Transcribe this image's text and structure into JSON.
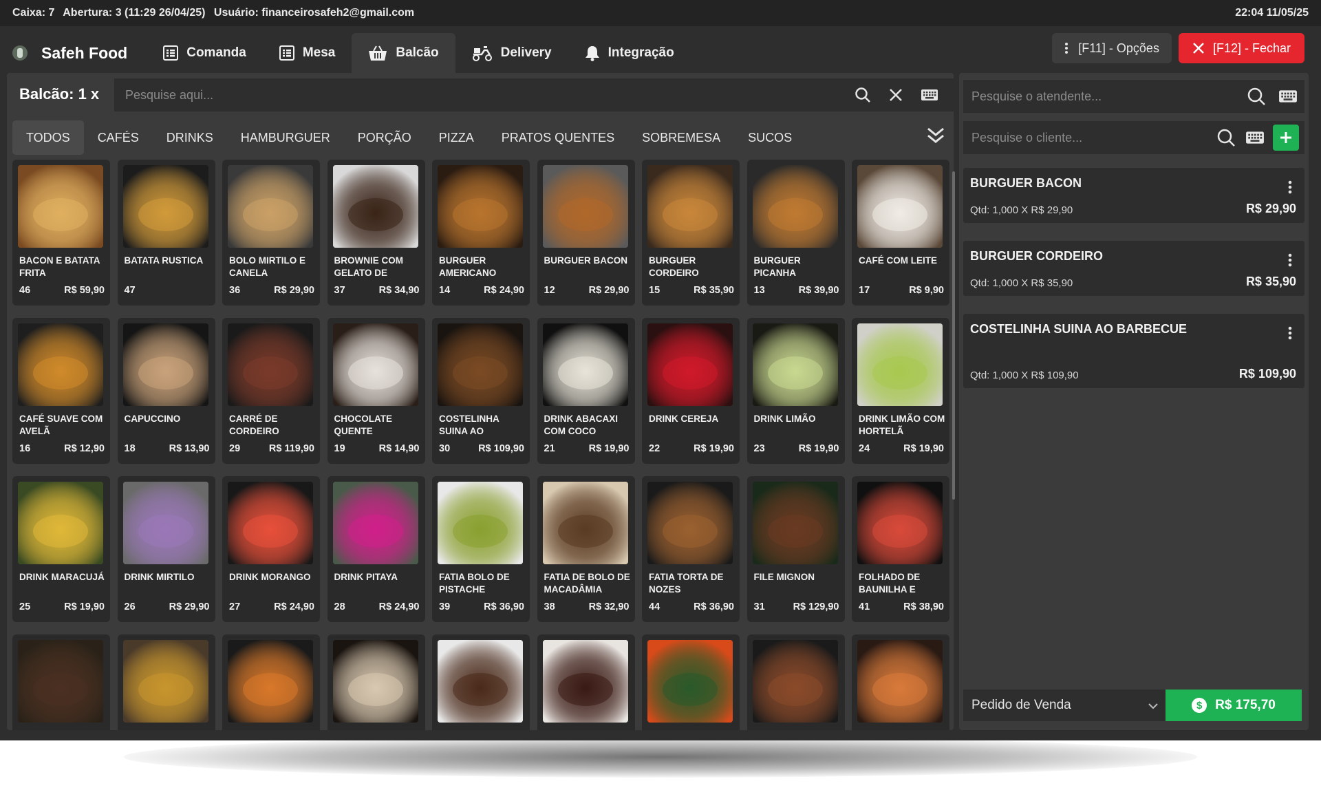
{
  "statusbar": {
    "caixa": "Caixa: 7",
    "abertura": "Abertura: 3 (11:29 26/04/25)",
    "usuario": "Usuário: financeirosafeh2@gmail.com",
    "datetime": "22:04 11/05/25"
  },
  "nav": {
    "brand": "Safeh Food",
    "tabs": [
      {
        "label": "Comanda",
        "icon": "list-icon"
      },
      {
        "label": "Mesa",
        "icon": "list-icon"
      },
      {
        "label": "Balcão",
        "icon": "basket-icon",
        "active": true
      },
      {
        "label": "Delivery",
        "icon": "scooter-icon"
      },
      {
        "label": "Integração",
        "icon": "bell-icon"
      }
    ],
    "options_label": "[F11] - Opções",
    "close_label": "[F12] - Fechar"
  },
  "balcao": {
    "title": "Balcão: 1 x",
    "search_placeholder": "Pesquise aqui...",
    "categories": [
      "TODOS",
      "CAFÉS",
      "DRINKS",
      "HAMBURGUER",
      "PORÇÃO",
      "PIZZA",
      "PRATOS QUENTES",
      "SOBREMESA",
      "SUCOS"
    ],
    "active_category": "TODOS"
  },
  "products": [
    {
      "name": "BACON E BATATA FRITA",
      "code": "46",
      "price": "R$ 59,90",
      "colors": [
        "#7a4a22",
        "#e0b060"
      ]
    },
    {
      "name": "BATATA RUSTICA",
      "code": "47",
      "price": "",
      "colors": [
        "#1c1c1c",
        "#d19a3a"
      ]
    },
    {
      "name": "BOLO MIRTILO E CANELA",
      "code": "36",
      "price": "R$ 29,90",
      "colors": [
        "#3a3a3a",
        "#caa066"
      ]
    },
    {
      "name": "BROWNIE COM GELATO DE",
      "code": "37",
      "price": "R$ 34,90",
      "colors": [
        "#d8d8d8",
        "#3a2418"
      ]
    },
    {
      "name": "BURGUER AMERICANO",
      "code": "14",
      "price": "R$ 24,90",
      "colors": [
        "#2b1c12",
        "#b8742e"
      ]
    },
    {
      "name": "BURGUER BACON",
      "code": "12",
      "price": "R$ 29,90",
      "colors": [
        "#5a5a5a",
        "#b0682a"
      ]
    },
    {
      "name": "BURGUER CORDEIRO",
      "code": "15",
      "price": "R$ 35,90",
      "colors": [
        "#3a2a1e",
        "#c8863a"
      ]
    },
    {
      "name": "BURGUER PICANHA",
      "code": "13",
      "price": "R$ 39,90",
      "colors": [
        "#2a2a2a",
        "#c07a32"
      ]
    },
    {
      "name": "CAFÉ COM LEITE",
      "code": "17",
      "price": "R$ 9,90",
      "colors": [
        "#5a4838",
        "#f0ece6"
      ]
    },
    {
      "name": "CAFÉ SUAVE COM AVELÃ",
      "code": "16",
      "price": "R$ 12,90",
      "colors": [
        "#1e1e1e",
        "#d08a2a"
      ]
    },
    {
      "name": "CAPUCCINO",
      "code": "18",
      "price": "R$ 13,90",
      "colors": [
        "#151515",
        "#c9a27a"
      ]
    },
    {
      "name": "CARRÉ DE CORDEIRO",
      "code": "29",
      "price": "R$ 119,90",
      "colors": [
        "#1a1a1a",
        "#7a3a2a"
      ]
    },
    {
      "name": "CHOCOLATE QUENTE",
      "code": "19",
      "price": "R$ 14,90",
      "colors": [
        "#2a1e18",
        "#e8e2dc"
      ]
    },
    {
      "name": "COSTELINHA SUINA AO",
      "code": "30",
      "price": "R$ 109,90",
      "colors": [
        "#1a1410",
        "#7a4a24"
      ]
    },
    {
      "name": "DRINK ABACAXI COM COCO",
      "code": "21",
      "price": "R$ 19,90",
      "colors": [
        "#101010",
        "#e8e4d8"
      ]
    },
    {
      "name": "DRINK CEREJA",
      "code": "22",
      "price": "R$ 19,90",
      "colors": [
        "#2a1010",
        "#d01a2a"
      ]
    },
    {
      "name": "DRINK LIMÃO",
      "code": "23",
      "price": "R$ 19,90",
      "colors": [
        "#1a1a14",
        "#c8d890"
      ]
    },
    {
      "name": "DRINK LIMÃO COM HORTELÃ",
      "code": "24",
      "price": "R$ 19,90",
      "colors": [
        "#d0d0c8",
        "#a8c850"
      ]
    },
    {
      "name": "DRINK MARACUJÁ",
      "code": "25",
      "price": "R$ 19,90",
      "colors": [
        "#3a4a22",
        "#e0b838"
      ]
    },
    {
      "name": "DRINK MIRTILO",
      "code": "26",
      "price": "R$ 29,90",
      "colors": [
        "#6a6a6a",
        "#9a78b8"
      ]
    },
    {
      "name": "DRINK MORANGO",
      "code": "27",
      "price": "R$ 24,90",
      "colors": [
        "#181818",
        "#e8503a"
      ]
    },
    {
      "name": "DRINK PITAYA",
      "code": "28",
      "price": "R$ 24,90",
      "colors": [
        "#4a5a4a",
        "#d0208a"
      ]
    },
    {
      "name": "FATIA BOLO DE PISTACHE",
      "code": "39",
      "price": "R$ 36,90",
      "colors": [
        "#e8e8e8",
        "#8aa030"
      ]
    },
    {
      "name": "FATIA DE BOLO DE MACADÂMIA",
      "code": "38",
      "price": "R$ 32,90",
      "colors": [
        "#d8c8b0",
        "#5a3a22"
      ]
    },
    {
      "name": "FATIA TORTA DE NOZES",
      "code": "44",
      "price": "R$ 36,90",
      "colors": [
        "#1a1a1a",
        "#9a6030"
      ]
    },
    {
      "name": "FILE MIGNON",
      "code": "31",
      "price": "R$ 129,90",
      "colors": [
        "#1a2a1a",
        "#6a3a22"
      ]
    },
    {
      "name": "FOLHADO DE BAUNILHA E",
      "code": "41",
      "price": "R$ 38,90",
      "colors": [
        "#101010",
        "#d84a3a"
      ]
    },
    {
      "name": "",
      "code": "",
      "price": "",
      "colors": [
        "#2a2218",
        "#4a3022"
      ]
    },
    {
      "name": "",
      "code": "",
      "price": "",
      "colors": [
        "#4a3a2a",
        "#c8962e"
      ]
    },
    {
      "name": "",
      "code": "",
      "price": "",
      "colors": [
        "#1a1a1a",
        "#d8782a"
      ]
    },
    {
      "name": "",
      "code": "",
      "price": "",
      "colors": [
        "#1a1410",
        "#d8c8b0"
      ]
    },
    {
      "name": "",
      "code": "",
      "price": "",
      "colors": [
        "#e8e8e8",
        "#4a2a1a"
      ]
    },
    {
      "name": "",
      "code": "",
      "price": "",
      "colors": [
        "#e8e4e0",
        "#3a1a14"
      ]
    },
    {
      "name": "",
      "code": "",
      "price": "",
      "colors": [
        "#d84a1a",
        "#2a5a2a"
      ]
    },
    {
      "name": "",
      "code": "",
      "price": "",
      "colors": [
        "#1a1a1a",
        "#8a4a2a"
      ]
    },
    {
      "name": "",
      "code": "",
      "price": "",
      "colors": [
        "#2a1a14",
        "#d87a3a"
      ]
    }
  ],
  "sidebar": {
    "attendant_placeholder": "Pesquise o atendente...",
    "client_placeholder": "Pesquise o cliente...",
    "items": [
      {
        "title": "BURGUER BACON",
        "qty": "Qtd: 1,000 X R$ 29,90",
        "total": "R$ 29,90"
      },
      {
        "title": "BURGUER CORDEIRO",
        "qty": "Qtd: 1,000 X R$ 35,90",
        "total": "R$ 35,90"
      },
      {
        "title": "COSTELINHA SUINA AO BARBECUE",
        "qty": "Qtd: 1,000 X R$ 109,90",
        "total": "R$ 109,90"
      }
    ],
    "order_type": "Pedido de Venda",
    "grand_total": "R$ 175,70"
  },
  "colors": {
    "accent_green": "#1fb254",
    "close_red": "#e5262e",
    "background": "#2e2e2e",
    "panel": "#3b3b3b"
  }
}
